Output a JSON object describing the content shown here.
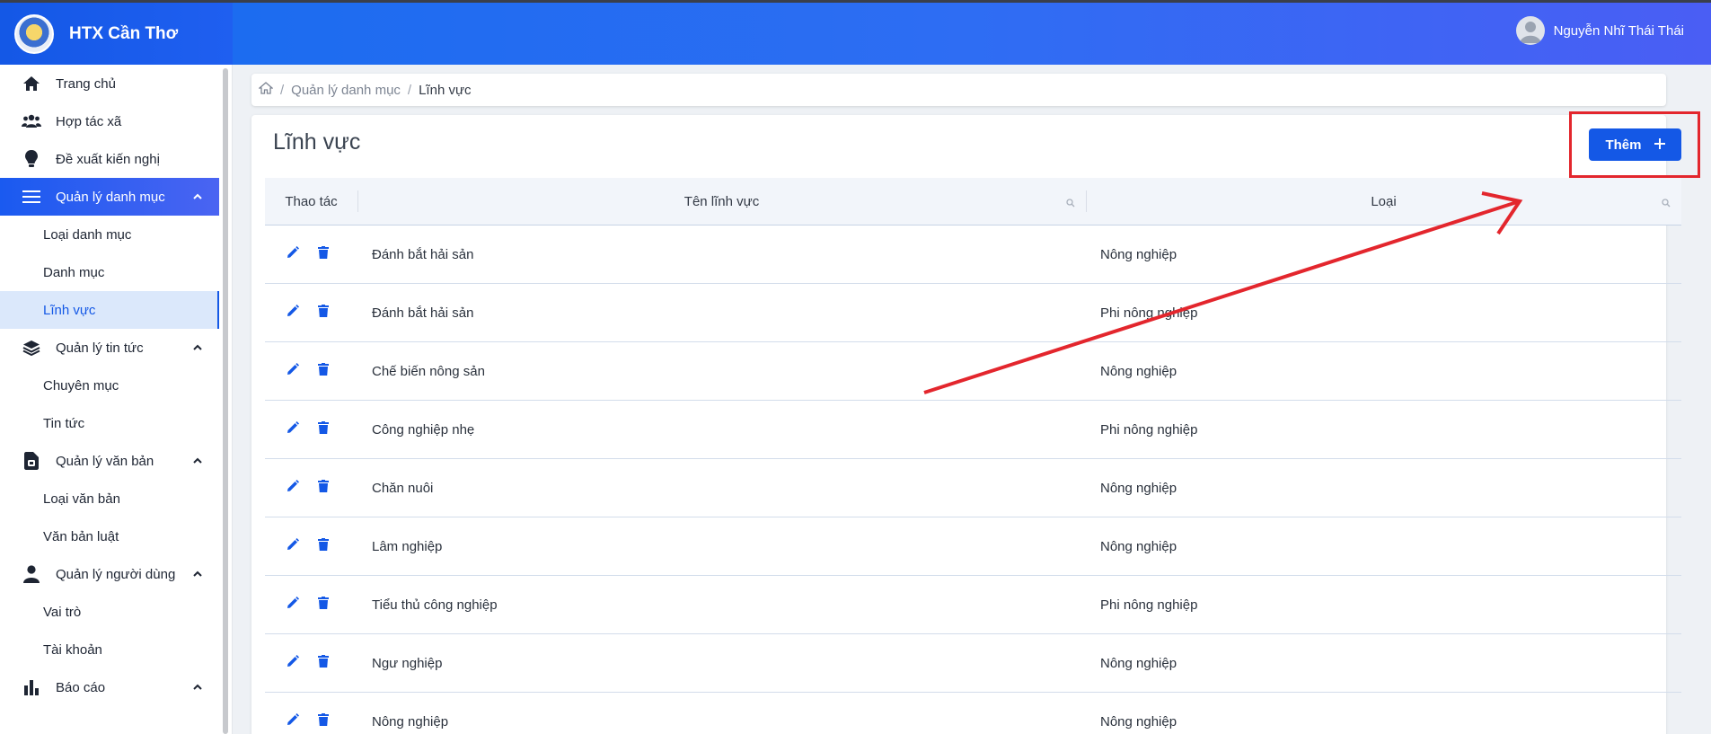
{
  "app": {
    "title": "HTX Cần Thơ"
  },
  "header": {
    "user_name": "Nguyễn Nhĩ Thái Thái"
  },
  "sidebar": {
    "items": [
      {
        "label": "Trang chủ",
        "icon": "home-icon"
      },
      {
        "label": "Hợp tác xã",
        "icon": "users-icon"
      },
      {
        "label": "Đề xuất kiến nghị",
        "icon": "lightbulb-icon"
      },
      {
        "label": "Quản lý danh mục",
        "icon": "menu-icon",
        "active": true,
        "children": [
          "Loại danh mục",
          "Danh mục",
          "Lĩnh vực"
        ]
      },
      {
        "label": "Quản lý tin tức",
        "icon": "layers-icon",
        "children": [
          "Chuyên mục",
          "Tin tức"
        ]
      },
      {
        "label": "Quản lý văn bản",
        "icon": "document-icon",
        "children": [
          "Loại văn bản",
          "Văn bản luật"
        ]
      },
      {
        "label": "Quản lý người dùng",
        "icon": "user-icon",
        "children": [
          "Vai trò",
          "Tài khoản"
        ]
      },
      {
        "label": "Báo cáo",
        "icon": "bar-chart-icon"
      }
    ]
  },
  "breadcrumb": {
    "parent": "Quản lý danh mục",
    "current": "Lĩnh vực"
  },
  "page": {
    "title": "Lĩnh vực",
    "add_label": "Thêm"
  },
  "table": {
    "columns": [
      "Thao tác",
      "Tên lĩnh vực",
      "Loại"
    ],
    "rows": [
      {
        "name": "Đánh bắt hải sản",
        "type": "Nông nghiệp"
      },
      {
        "name": "Đánh bắt hải sản",
        "type": "Phi nông nghiệp"
      },
      {
        "name": "Chế biến nông sản",
        "type": "Nông nghiệp"
      },
      {
        "name": "Công nghiệp nhẹ",
        "type": "Phi nông nghiệp"
      },
      {
        "name": "Chăn nuôi",
        "type": "Nông nghiệp"
      },
      {
        "name": "Lâm nghiệp",
        "type": "Nông nghiệp"
      },
      {
        "name": "Tiểu thủ công nghiệp",
        "type": "Phi nông nghiệp"
      },
      {
        "name": "Ngư nghiệp",
        "type": "Nông nghiệp"
      },
      {
        "name": "Nông nghiệp",
        "type": "Nông nghiệp"
      }
    ]
  },
  "colors": {
    "primary": "#1458e6",
    "annotation": "#e3262d"
  }
}
